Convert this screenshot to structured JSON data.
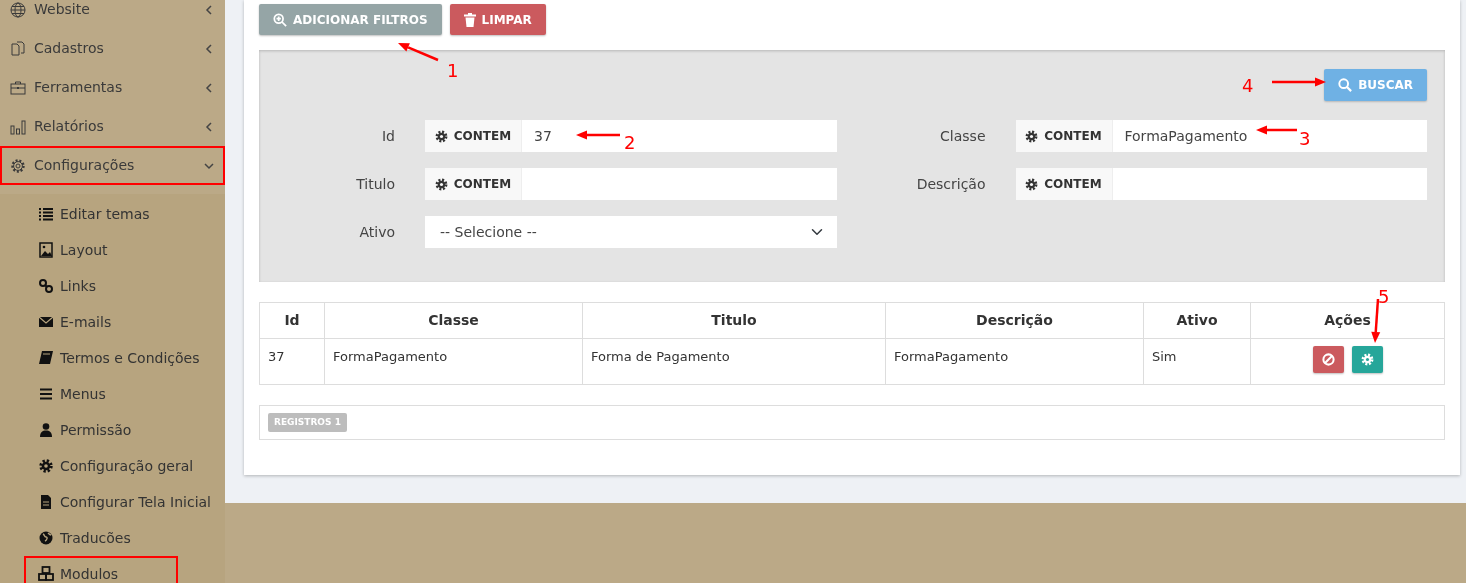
{
  "sidebar": {
    "items": [
      {
        "label": "Website",
        "expanded": false,
        "highlighted": false
      },
      {
        "label": "Cadastros",
        "expanded": false,
        "highlighted": false
      },
      {
        "label": "Ferramentas",
        "expanded": false,
        "highlighted": false
      },
      {
        "label": "Relatórios",
        "expanded": false,
        "highlighted": false
      },
      {
        "label": "Configurações",
        "expanded": true,
        "highlighted": true,
        "children": [
          {
            "label": "Editar temas",
            "highlighted": false
          },
          {
            "label": "Layout",
            "highlighted": false
          },
          {
            "label": "Links",
            "highlighted": false
          },
          {
            "label": "E-mails",
            "highlighted": false
          },
          {
            "label": "Termos e Condições",
            "highlighted": false
          },
          {
            "label": "Menus",
            "highlighted": false
          },
          {
            "label": "Permissão",
            "highlighted": false
          },
          {
            "label": "Configuração geral",
            "highlighted": false
          },
          {
            "label": "Configurar Tela Inicial",
            "highlighted": false
          },
          {
            "label": "Traducões",
            "highlighted": false
          },
          {
            "label": "Modulos",
            "highlighted": true
          }
        ]
      }
    ]
  },
  "toolbar": [
    {
      "label": "ADICIONAR FILTROS",
      "kind": "secondary"
    },
    {
      "label": "LIMPAR",
      "kind": "danger"
    }
  ],
  "filter_panel": {
    "search_button": "BUSCAR",
    "filters": [
      {
        "label": "Id",
        "kind": "text",
        "operator": "CONTEM",
        "value": "37"
      },
      {
        "label": "Classe",
        "kind": "text",
        "operator": "CONTEM",
        "value": "FormaPagamento"
      },
      {
        "label": "Titulo",
        "kind": "text",
        "operator": "CONTEM"
      },
      {
        "label": "Descrição",
        "kind": "text",
        "operator": "CONTEM"
      },
      {
        "label": "Ativo",
        "kind": "select",
        "value": "-- Selecione --"
      }
    ]
  },
  "table": {
    "columns": [
      "Id",
      "Classe",
      "Titulo",
      "Descrição",
      "Ativo",
      "Ações"
    ],
    "rows": [
      {
        "cells": [
          "37",
          "FormaPagamento",
          "Forma de Pagamento",
          "FormaPagamento",
          "Sim"
        ],
        "actions": [
          {
            "kind": "block"
          },
          {
            "kind": "settings"
          }
        ]
      }
    ]
  },
  "records_badge": "REGISTROS 1",
  "annotations": [
    {
      "label": "1"
    },
    {
      "label": "2"
    },
    {
      "label": "3"
    },
    {
      "label": "4"
    },
    {
      "label": "5"
    }
  ]
}
